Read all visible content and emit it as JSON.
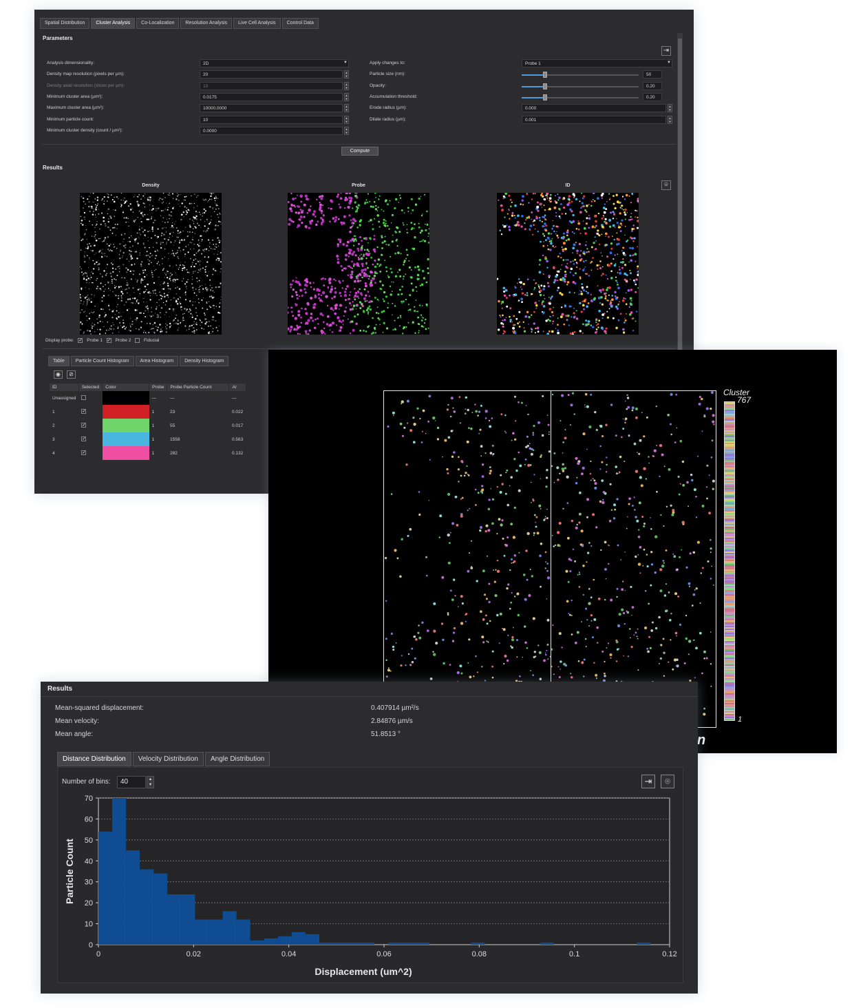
{
  "top_window": {
    "tabs": [
      "Spatial Distribution",
      "Cluster Analysis",
      "Co-Localization",
      "Resolution Analysis",
      "Live Cell Analysis",
      "Control Data"
    ],
    "active_tab": "Cluster Analysis",
    "parameters_title": "Parameters",
    "left_params": [
      {
        "label": "Analysis dimensionality:",
        "value": "2D",
        "kind": "dropdown"
      },
      {
        "label": "Density map resolution (pixels per µm):",
        "value": "20",
        "kind": "spin"
      },
      {
        "label": "Density axial resolution (slices per µm):",
        "value": "10",
        "kind": "spin",
        "disabled": true
      },
      {
        "label": "Minimum cluster area (µm²):",
        "value": "0.0175",
        "kind": "spin"
      },
      {
        "label": "Maximum cluster area (µm²):",
        "value": "10000.0000",
        "kind": "spin"
      },
      {
        "label": "Minimum particle count:",
        "value": "10",
        "kind": "spin"
      },
      {
        "label": "Minimum cluster density (count / µm²):",
        "value": "0.0000",
        "kind": "spin"
      }
    ],
    "right_params": [
      {
        "label": "Apply changes to:",
        "value": "Probe 1",
        "kind": "dropdown"
      },
      {
        "label": "Particle size (nm):",
        "value": "50",
        "kind": "slider",
        "level": 0.2
      },
      {
        "label": "Opacity:",
        "value": "0.20",
        "kind": "slider",
        "level": 0.2
      },
      {
        "label": "Accumulation threshold:",
        "value": "0.20",
        "kind": "slider",
        "level": 0.2
      },
      {
        "label": "Erode radius (µm):",
        "value": "0.000",
        "kind": "spin"
      },
      {
        "label": "Dilate radius (µm):",
        "value": "0.001",
        "kind": "spin"
      }
    ],
    "compute_label": "Compute",
    "results_title": "Results",
    "image_titles": [
      "Density",
      "Probe",
      "ID"
    ],
    "display_probe_label": "Display probe:",
    "display_probes": [
      {
        "label": "Probe 1",
        "checked": true
      },
      {
        "label": "Probe 2",
        "checked": true
      },
      {
        "label": "Fiducial",
        "checked": false
      }
    ],
    "lower_tabs": [
      "Table",
      "Particle Count Histogram",
      "Area Histogram",
      "Density Histogram"
    ],
    "active_lower_tab": "Table",
    "table_headers": [
      "ID",
      "Selected",
      "Color",
      "Probe",
      "Probe Particle Count",
      "Ar"
    ],
    "table_rows": [
      {
        "id": "Unassigned",
        "selected": false,
        "color": "#000000",
        "probe": "—",
        "count": "—",
        "area": "—"
      },
      {
        "id": "1",
        "selected": true,
        "color": "#d11f26",
        "probe": "1",
        "count": "23",
        "area": "0.022"
      },
      {
        "id": "2",
        "selected": true,
        "color": "#6fd46a",
        "probe": "1",
        "count": "55",
        "area": "0.017"
      },
      {
        "id": "3",
        "selected": true,
        "color": "#49b6e0",
        "probe": "1",
        "count": "1558",
        "area": "0.563"
      },
      {
        "id": "4",
        "selected": true,
        "color": "#ef4fa2",
        "probe": "1",
        "count": "282",
        "area": "0.132"
      }
    ]
  },
  "cluster_panel": {
    "title": "Cluster",
    "max": "767",
    "min": "1",
    "partial_label": "n",
    "partial_mark": "t"
  },
  "bottom_window": {
    "results_title": "Results",
    "stats": [
      {
        "label": "Mean-squared displacement:",
        "value": "0.407914 µm²/s"
      },
      {
        "label": "Mean velocity:",
        "value": "2.84876 µm/s"
      },
      {
        "label": "Mean angle:",
        "value": "51.8513 °"
      }
    ],
    "tabs": [
      "Distance Distribution",
      "Velocity Distribution",
      "Angle Distribution"
    ],
    "active_tab": "Distance Distribution",
    "bins_label": "Number of bins:",
    "bins_value": "40"
  },
  "chart_data": {
    "type": "bar",
    "xlabel": "Displacement (um^2)",
    "ylabel": "Particle Count",
    "xlim": [
      0,
      0.12
    ],
    "ylim": [
      0,
      70
    ],
    "xticks": [
      "0",
      "0.02",
      "0.04",
      "0.06",
      "0.08",
      "0.1",
      "0.12"
    ],
    "yticks": [
      "0",
      "10",
      "20",
      "30",
      "40",
      "50",
      "60",
      "70"
    ],
    "grid": true,
    "bin_width": 0.0029,
    "bin_starts": [
      0,
      0.0029,
      0.0058,
      0.0087,
      0.0116,
      0.0145,
      0.0174,
      0.0203,
      0.0232,
      0.0261,
      0.029,
      0.0319,
      0.0348,
      0.0377,
      0.0406,
      0.0435,
      0.0464,
      0.0493,
      0.0522,
      0.0551,
      0.058,
      0.0609,
      0.0638,
      0.0667,
      0.0696,
      0.0725,
      0.0754,
      0.0783,
      0.0812,
      0.0841,
      0.087,
      0.0899,
      0.0928,
      0.0957,
      0.0986,
      0.1015,
      0.1044,
      0.1073,
      0.1102,
      0.1131
    ],
    "values": [
      54,
      70,
      45,
      36,
      34,
      24,
      24,
      12,
      12,
      16,
      12,
      2,
      3,
      4,
      6,
      5,
      1,
      1,
      1,
      1,
      0,
      1,
      1,
      1,
      0,
      0,
      0,
      1,
      0,
      0,
      0,
      0,
      1,
      0,
      0,
      0,
      0,
      0,
      0,
      1
    ],
    "bar_color": "#0f4c92"
  }
}
